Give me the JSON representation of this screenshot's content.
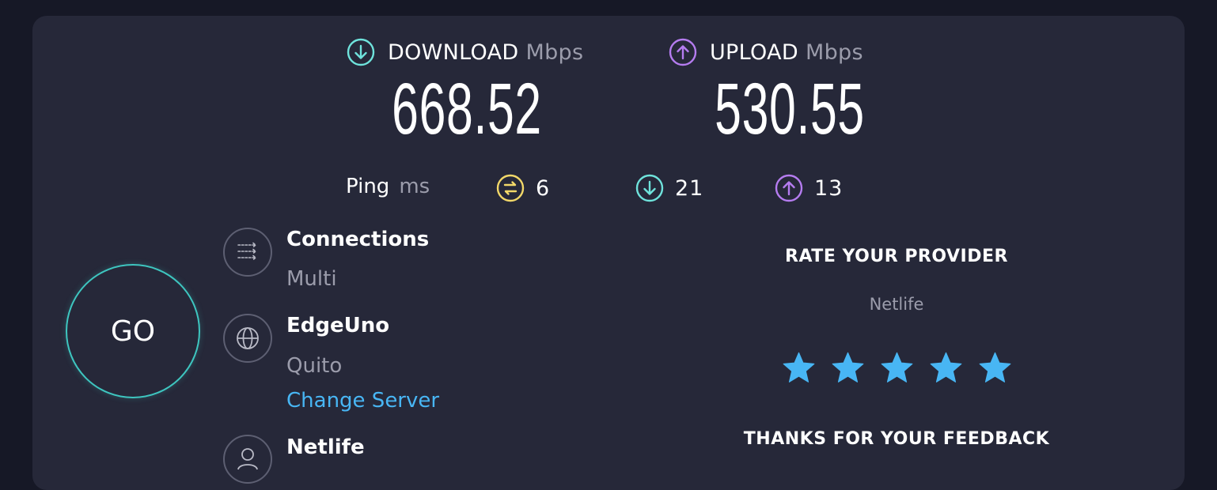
{
  "download": {
    "label": "DOWNLOAD",
    "unit": "Mbps",
    "value": "668.52",
    "icon": "download-arrow-icon",
    "color": "#6fe3dc"
  },
  "upload": {
    "label": "UPLOAD",
    "unit": "Mbps",
    "value": "530.55",
    "icon": "upload-arrow-icon",
    "color": "#b57cf0"
  },
  "ping": {
    "label": "Ping",
    "unit": "ms",
    "idle": {
      "value": "6",
      "icon": "ping-idle-icon",
      "color": "#f2d869"
    },
    "download": {
      "value": "21",
      "icon": "ping-download-icon",
      "color": "#6fe3dc"
    },
    "upload": {
      "value": "13",
      "icon": "ping-upload-icon",
      "color": "#b57cf0"
    }
  },
  "go_button": {
    "label": "GO",
    "color": "#3ec6c0"
  },
  "connections": {
    "title": "Connections",
    "value": "Multi",
    "icon": "connections-icon"
  },
  "server": {
    "title": "EdgeUno",
    "location": "Quito",
    "change_link": "Change Server",
    "icon": "globe-icon",
    "link_color": "#48b6f4"
  },
  "provider": {
    "title": "Netlife",
    "icon": "user-icon"
  },
  "rating": {
    "title": "RATE YOUR PROVIDER",
    "provider_name": "Netlife",
    "stars_selected": 5,
    "stars_total": 5,
    "star_color": "#48b6f4",
    "feedback_text": "THANKS FOR YOUR FEEDBACK"
  }
}
